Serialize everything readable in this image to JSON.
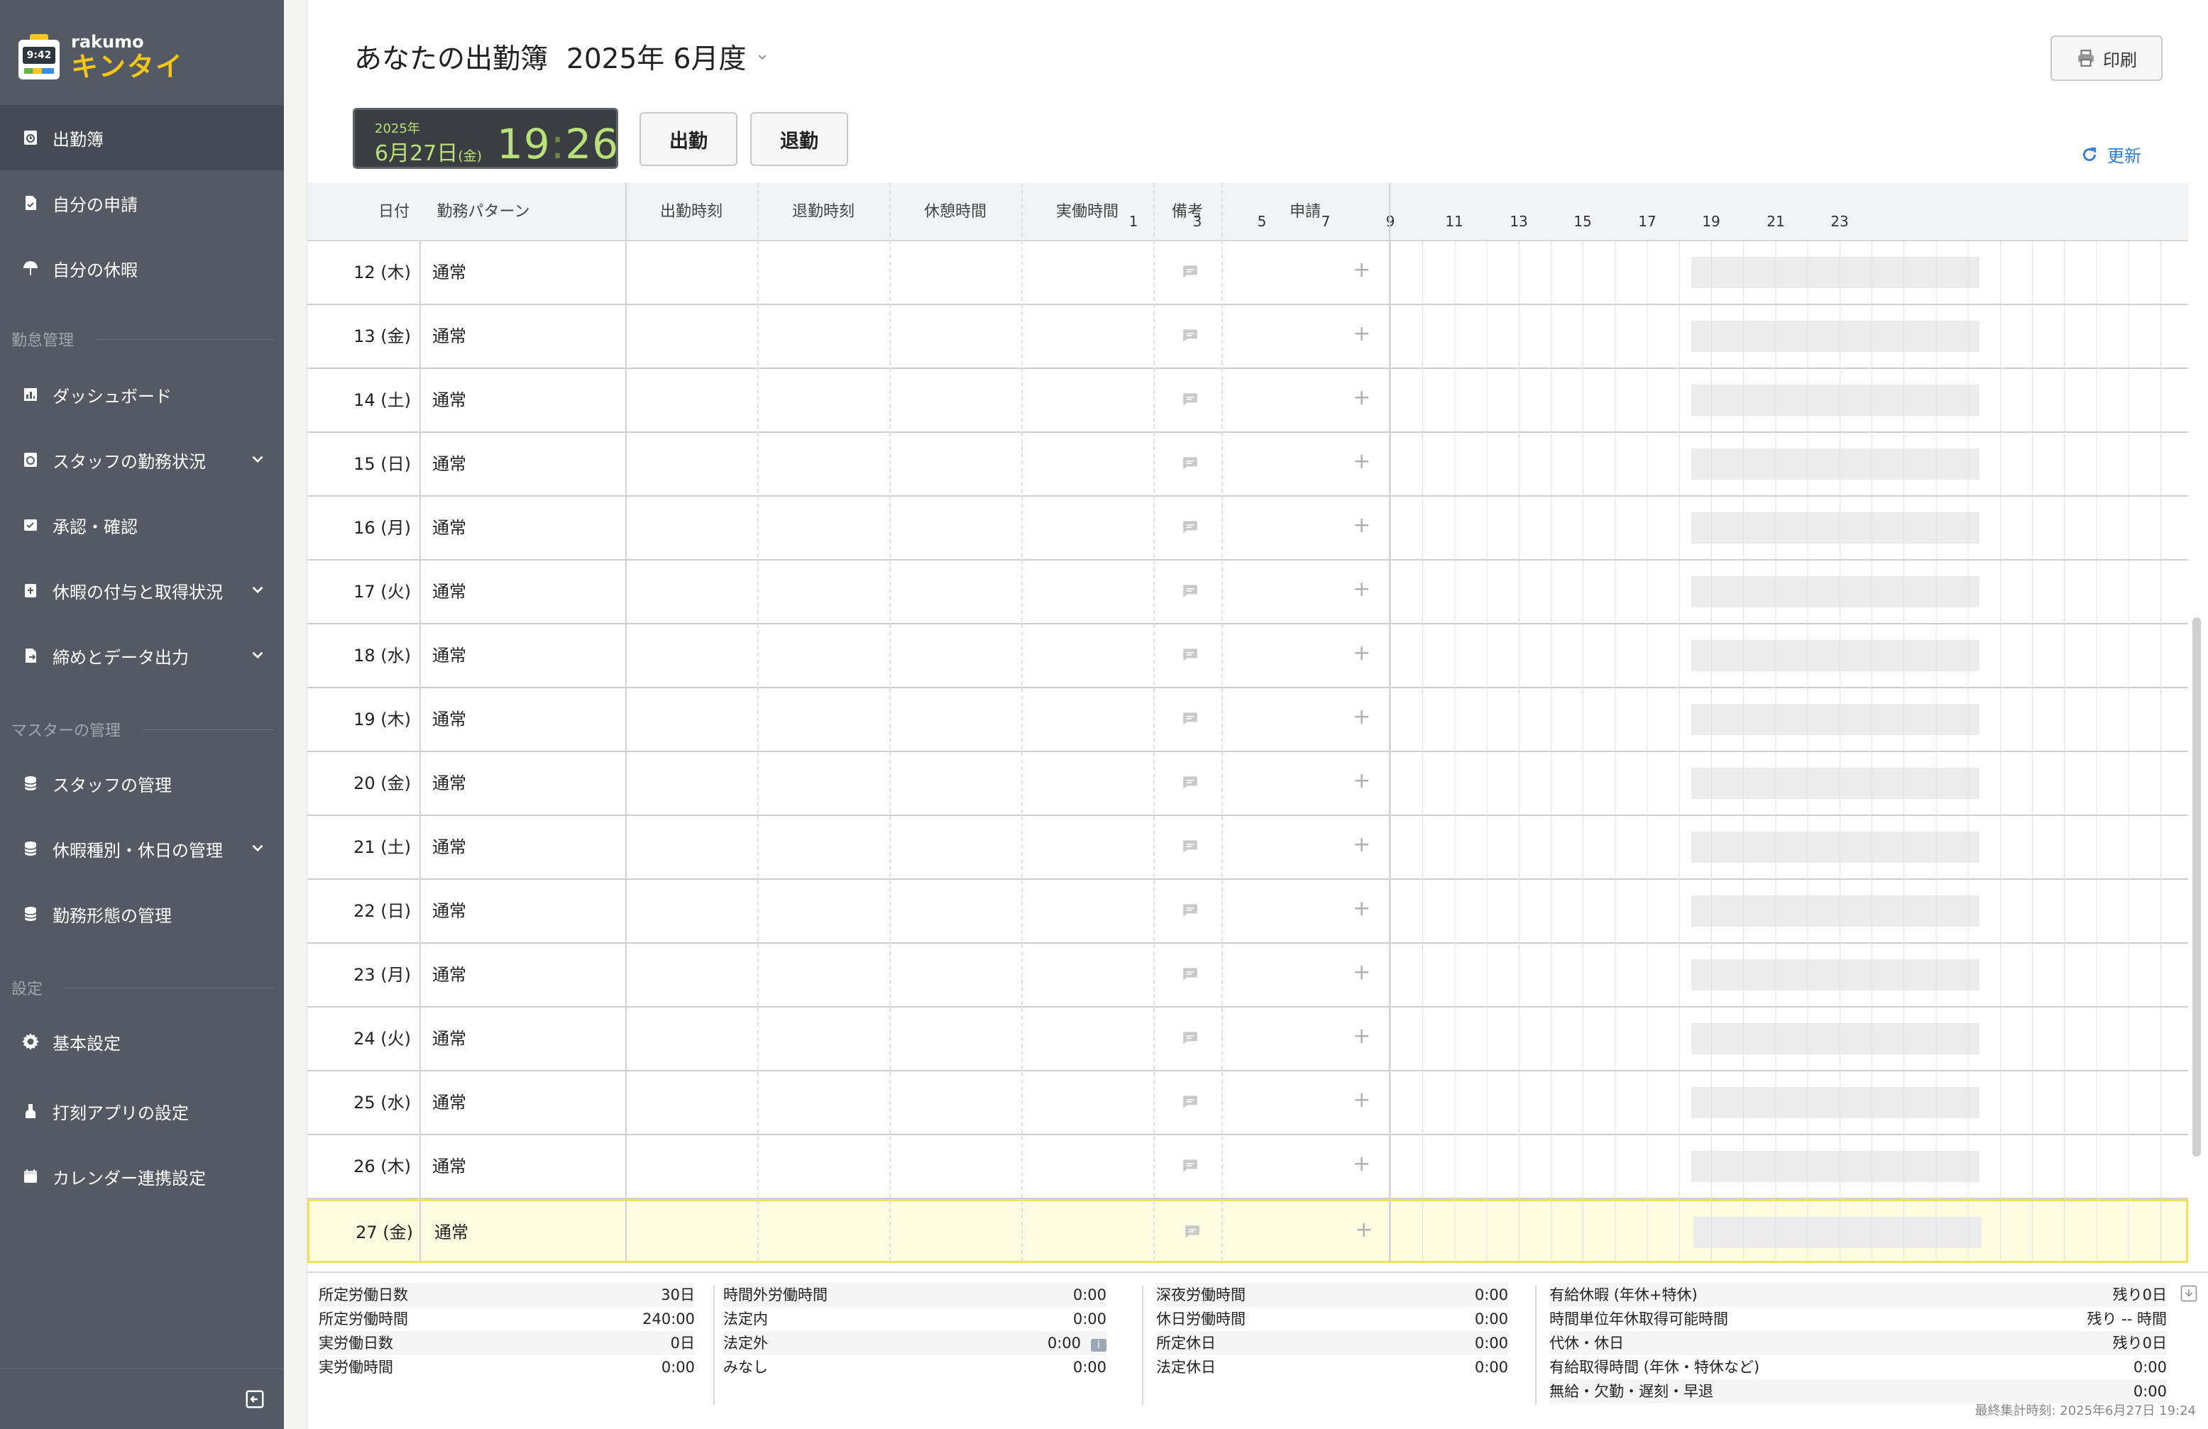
{
  "app": {
    "logo_small": "rakumo",
    "logo_big": "キンタイ",
    "logo_clock": "9:42"
  },
  "sidebar": {
    "items_top": [
      {
        "label": "出勤簿",
        "icon": "clock-book-icon",
        "active": true
      },
      {
        "label": "自分の申請",
        "icon": "request-doc-icon"
      },
      {
        "label": "自分の休暇",
        "icon": "vacation-icon"
      }
    ],
    "section_attendance": "勤怠管理",
    "items_attendance": [
      {
        "label": "ダッシュボード",
        "icon": "chart-icon",
        "expandable": false
      },
      {
        "label": "スタッフの勤務状況",
        "icon": "staff-status-icon",
        "expandable": true
      },
      {
        "label": "承認・確認",
        "icon": "approval-icon",
        "expandable": false
      },
      {
        "label": "休暇の付与と取得状況",
        "icon": "leave-grant-icon",
        "expandable": true
      },
      {
        "label": "締めとデータ出力",
        "icon": "export-icon",
        "expandable": true
      }
    ],
    "section_master": "マスターの管理",
    "items_master": [
      {
        "label": "スタッフの管理",
        "icon": "database-icon",
        "expandable": false
      },
      {
        "label": "休暇種別・休日の管理",
        "icon": "database-icon",
        "expandable": true
      },
      {
        "label": "勤務形態の管理",
        "icon": "database-icon",
        "expandable": false
      }
    ],
    "section_settings": "設定",
    "items_settings": [
      {
        "label": "基本設定",
        "icon": "gear-icon"
      },
      {
        "label": "打刻アプリの設定",
        "icon": "stamp-app-icon"
      },
      {
        "label": "カレンダー連携設定",
        "icon": "calendar-icon"
      }
    ]
  },
  "header": {
    "title": "あなたの出勤簿",
    "period": "2025年 6月度",
    "print_label": "印刷",
    "refresh_label": "更新"
  },
  "clock": {
    "year": "2025年",
    "date": "6月27日",
    "dow": "(金)",
    "hour": "19",
    "minute": "26"
  },
  "actions": {
    "clock_in": "出勤",
    "clock_out": "退勤"
  },
  "table": {
    "headers": [
      "日付",
      "勤務パターン",
      "出勤時刻",
      "退勤時刻",
      "休憩時間",
      "実働時間",
      "備考",
      "申請"
    ],
    "hours": [
      "1",
      "3",
      "5",
      "7",
      "9",
      "11",
      "13",
      "15",
      "17",
      "19",
      "21",
      "23"
    ],
    "rows": [
      {
        "date": "12 (木)",
        "pattern": "通常"
      },
      {
        "date": "13 (金)",
        "pattern": "通常"
      },
      {
        "date": "14 (土)",
        "pattern": "通常"
      },
      {
        "date": "15 (日)",
        "pattern": "通常"
      },
      {
        "date": "16 (月)",
        "pattern": "通常"
      },
      {
        "date": "17 (火)",
        "pattern": "通常"
      },
      {
        "date": "18 (水)",
        "pattern": "通常"
      },
      {
        "date": "19 (木)",
        "pattern": "通常"
      },
      {
        "date": "20 (金)",
        "pattern": "通常"
      },
      {
        "date": "21 (土)",
        "pattern": "通常"
      },
      {
        "date": "22 (日)",
        "pattern": "通常"
      },
      {
        "date": "23 (月)",
        "pattern": "通常"
      },
      {
        "date": "24 (火)",
        "pattern": "通常"
      },
      {
        "date": "25 (水)",
        "pattern": "通常"
      },
      {
        "date": "26 (木)",
        "pattern": "通常"
      },
      {
        "date": "27 (金)",
        "pattern": "通常",
        "today": true
      }
    ]
  },
  "summary": {
    "col1": [
      {
        "label": "所定労働日数",
        "value": "30日"
      },
      {
        "label": "所定労働時間",
        "value": "240:00"
      },
      {
        "label": "実労働日数",
        "value": "0日"
      },
      {
        "label": "実労働時間",
        "value": "0:00"
      }
    ],
    "col2": [
      {
        "label": "時間外労働時間",
        "value": "0:00"
      },
      {
        "label": "法定内",
        "value": "0:00"
      },
      {
        "label": "法定外",
        "value": "0:00",
        "info": "i"
      },
      {
        "label": "みなし",
        "value": "0:00"
      }
    ],
    "col3": [
      {
        "label": "深夜労働時間",
        "value": "0:00"
      },
      {
        "label": "休日労働時間",
        "value": "0:00"
      },
      {
        "label": "所定休日",
        "value": "0:00"
      },
      {
        "label": "法定休日",
        "value": "0:00"
      }
    ],
    "col4": [
      {
        "label": "有給休暇 (年休+特休)",
        "value": "残り0日"
      },
      {
        "label": "時間単位年休取得可能時間",
        "value": "残り -- 時間"
      },
      {
        "label": "代休・休日",
        "value": "残り0日"
      },
      {
        "label": "有給取得時間 (年休・特休など)",
        "value": "0:00"
      },
      {
        "label": "無給・欠勤・遅刻・早退",
        "value": "0:00"
      }
    ],
    "last_updated": "最終集計時刻: 2025年6月27日 19:24"
  },
  "colors": {
    "sidebar_bg": "#535a64",
    "accent_blue": "#2d7fd6",
    "clock_green": "#b9e07a",
    "today_highlight": "#fffbe0"
  }
}
